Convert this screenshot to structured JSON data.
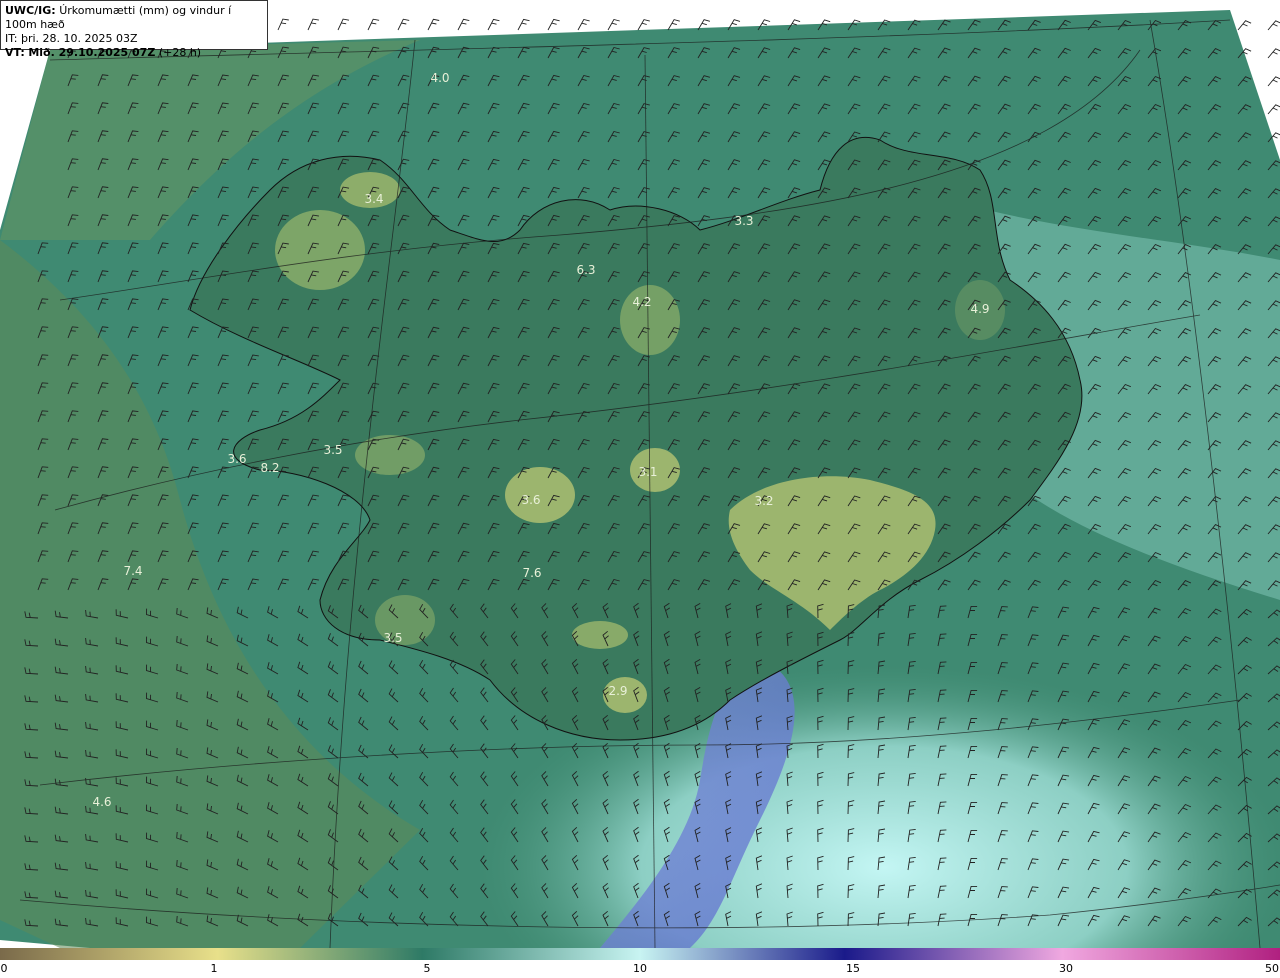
{
  "header": {
    "product": "UWC/IG:",
    "description": "Úrkomumætti (mm) og vindur í 100m hæð",
    "issue_time": "IT: þri. 28. 10. 2025 03Z",
    "valid_prefix": "VT:",
    "valid_time": "Mið. 29.10.2025 07Z",
    "lead": "(+28 h)"
  },
  "map_labels": [
    "4.0",
    "3.4",
    "3.3",
    "6.3",
    "4.2",
    "4.9",
    "3.6",
    "8.2",
    "3.5",
    "3.1",
    "3.6",
    "3.2",
    "7.4",
    "7.6",
    "3.5",
    "2.9",
    "4.6"
  ],
  "colorbar": {
    "ticks": [
      "0",
      "1",
      "5",
      "10",
      "15",
      "30",
      "50"
    ],
    "colors": [
      "#7a6a4a",
      "#e8e08a",
      "#2e7a66",
      "#c8f4f2",
      "#1a1a8a",
      "#f0a8e0",
      "#b02080"
    ]
  },
  "colors": {
    "sea_dark": "#3f8a72",
    "land": "#3e7f63",
    "highland": "#8fb06a",
    "wet": "#b5ecea",
    "heavy": "#6f7fd0"
  }
}
